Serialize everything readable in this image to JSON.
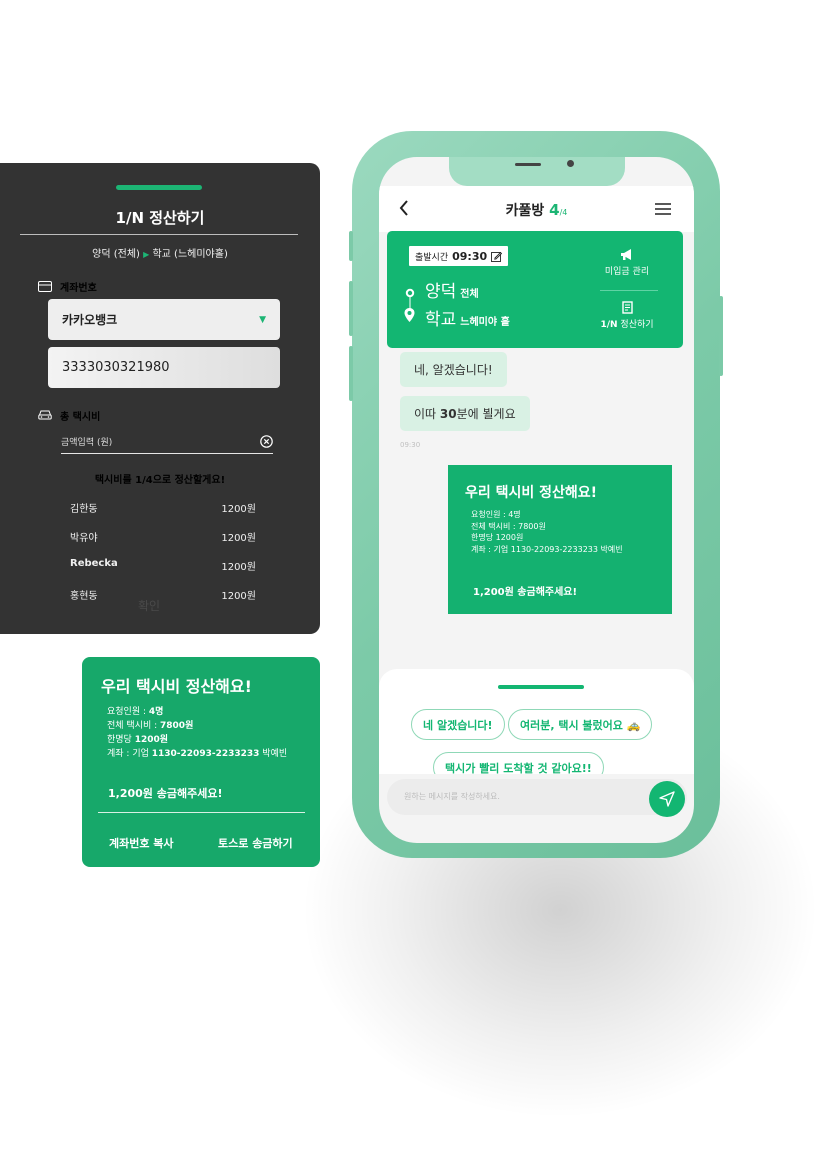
{
  "settle_panel": {
    "title": "1/N 정산하기",
    "route_from": "양덕 (전체)",
    "route_arrow": "▶",
    "route_to": "학교 (느헤미야홀)",
    "account_label": "계좌번호",
    "bank_name": "카카오뱅크",
    "account_number": "3333030321980",
    "fare_label": "총 택시비",
    "amount_placeholder": "금액입력 (원)",
    "split_note": "택시비를 1/4으로 정산할게요!",
    "members": [
      {
        "name": "김한동",
        "amount": "1200원"
      },
      {
        "name": "박유야",
        "amount": "1200원"
      },
      {
        "name": "Rebecka",
        "amount": "1200원"
      },
      {
        "name": "홍현동",
        "amount": "1200원"
      }
    ],
    "confirm_label": "확인"
  },
  "receipt_card": {
    "title": "우리 택시비 정산해요!",
    "people_label": "요청인원 : ",
    "people_value": "4명",
    "total_label": "전체 택시비 : ",
    "total_value": "7800원",
    "per_label": "한명당 ",
    "per_value": "1200원",
    "account_label": "계좌 : 기업 ",
    "account_value": "1130-22093-2233233",
    "account_owner": " 박예빈",
    "pay_message": "1,200원 송금해주세요!",
    "copy_button": "계좌번호 복사",
    "toss_button": "토스로 송금하기"
  },
  "phone": {
    "header": {
      "title": "카풀방",
      "count": "4",
      "total": "/4"
    },
    "route_card": {
      "depart_label": "출발시간",
      "depart_time": "09:30",
      "from_place": "양덕",
      "from_detail": "전체",
      "to_place": "학교",
      "to_detail": "느헤미야 홀",
      "unpaid_label": "미입금 관리",
      "settle_prefix": "1/N",
      "settle_label": "정산하기"
    },
    "messages": [
      {
        "text": "네, 알겠습니다!"
      },
      {
        "pre": "이따 ",
        "bold": "30",
        "post": "분에 뵐게요"
      }
    ],
    "message_time": "09:30",
    "settle_card": {
      "title": "우리 택시비 정산해요!",
      "people": "요청인원 : 4명",
      "total": "전체 택시비 : 7800원",
      "per": "한명당 1200원",
      "account": "계좌 : 기업 1130-22093-2233233 박예빈",
      "pay_message": "1,200원 송금해주세요!"
    },
    "quick_replies": [
      "네 알겠습니다!",
      "여러분, 택시 불렀어요 🚕",
      "택시가 빨리 도착할 것 같아요!!"
    ],
    "input_placeholder": "원하는 메시지를 작성하세요."
  },
  "colors": {
    "brand_green": "#13b672",
    "dark_panel": "#333333",
    "phone_body": "#7ccaa8"
  },
  "icons": [
    "card-icon",
    "taxi-icon",
    "clear-icon",
    "back-icon",
    "menu-icon",
    "edit-icon",
    "pin-icon",
    "megaphone-icon",
    "receipt-icon",
    "send-icon"
  ]
}
